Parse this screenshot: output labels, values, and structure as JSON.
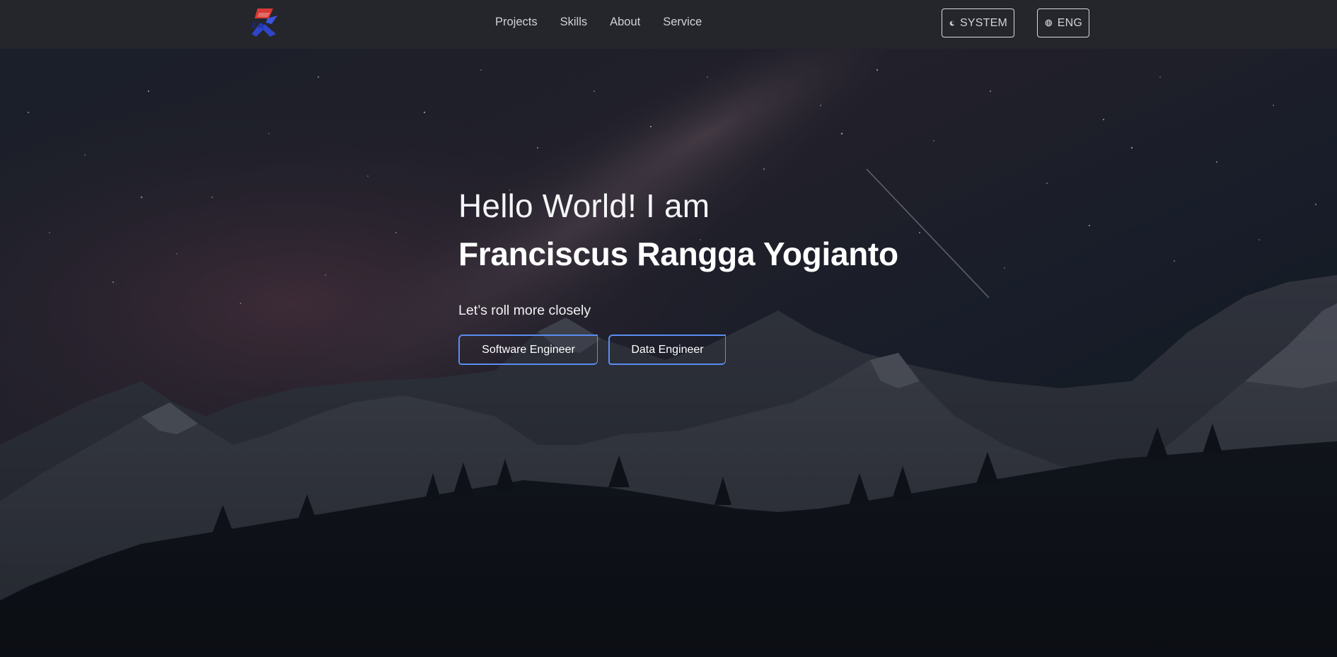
{
  "navbar": {
    "logo_icon": "fry-logo-icon",
    "links": [
      {
        "label": "Projects"
      },
      {
        "label": "Skills"
      },
      {
        "label": "About"
      },
      {
        "label": "Service"
      }
    ],
    "theme_toggle": {
      "icon": "moon-icon",
      "label": "SYSTEM"
    },
    "language_toggle": {
      "icon": "globe-icon",
      "label": "ENG"
    }
  },
  "hero": {
    "greeting": "Hello World! I am",
    "name": "Franciscus Rangga Yogianto",
    "tagline": "Let’s roll more closely",
    "roles": [
      {
        "label": "Software Engineer"
      },
      {
        "label": "Data Engineer"
      }
    ],
    "background": "night-sky-mountains-image"
  },
  "colors": {
    "navbar_bg": "#24262c",
    "accent_border": "#5b8def",
    "text": "#ffffff"
  }
}
